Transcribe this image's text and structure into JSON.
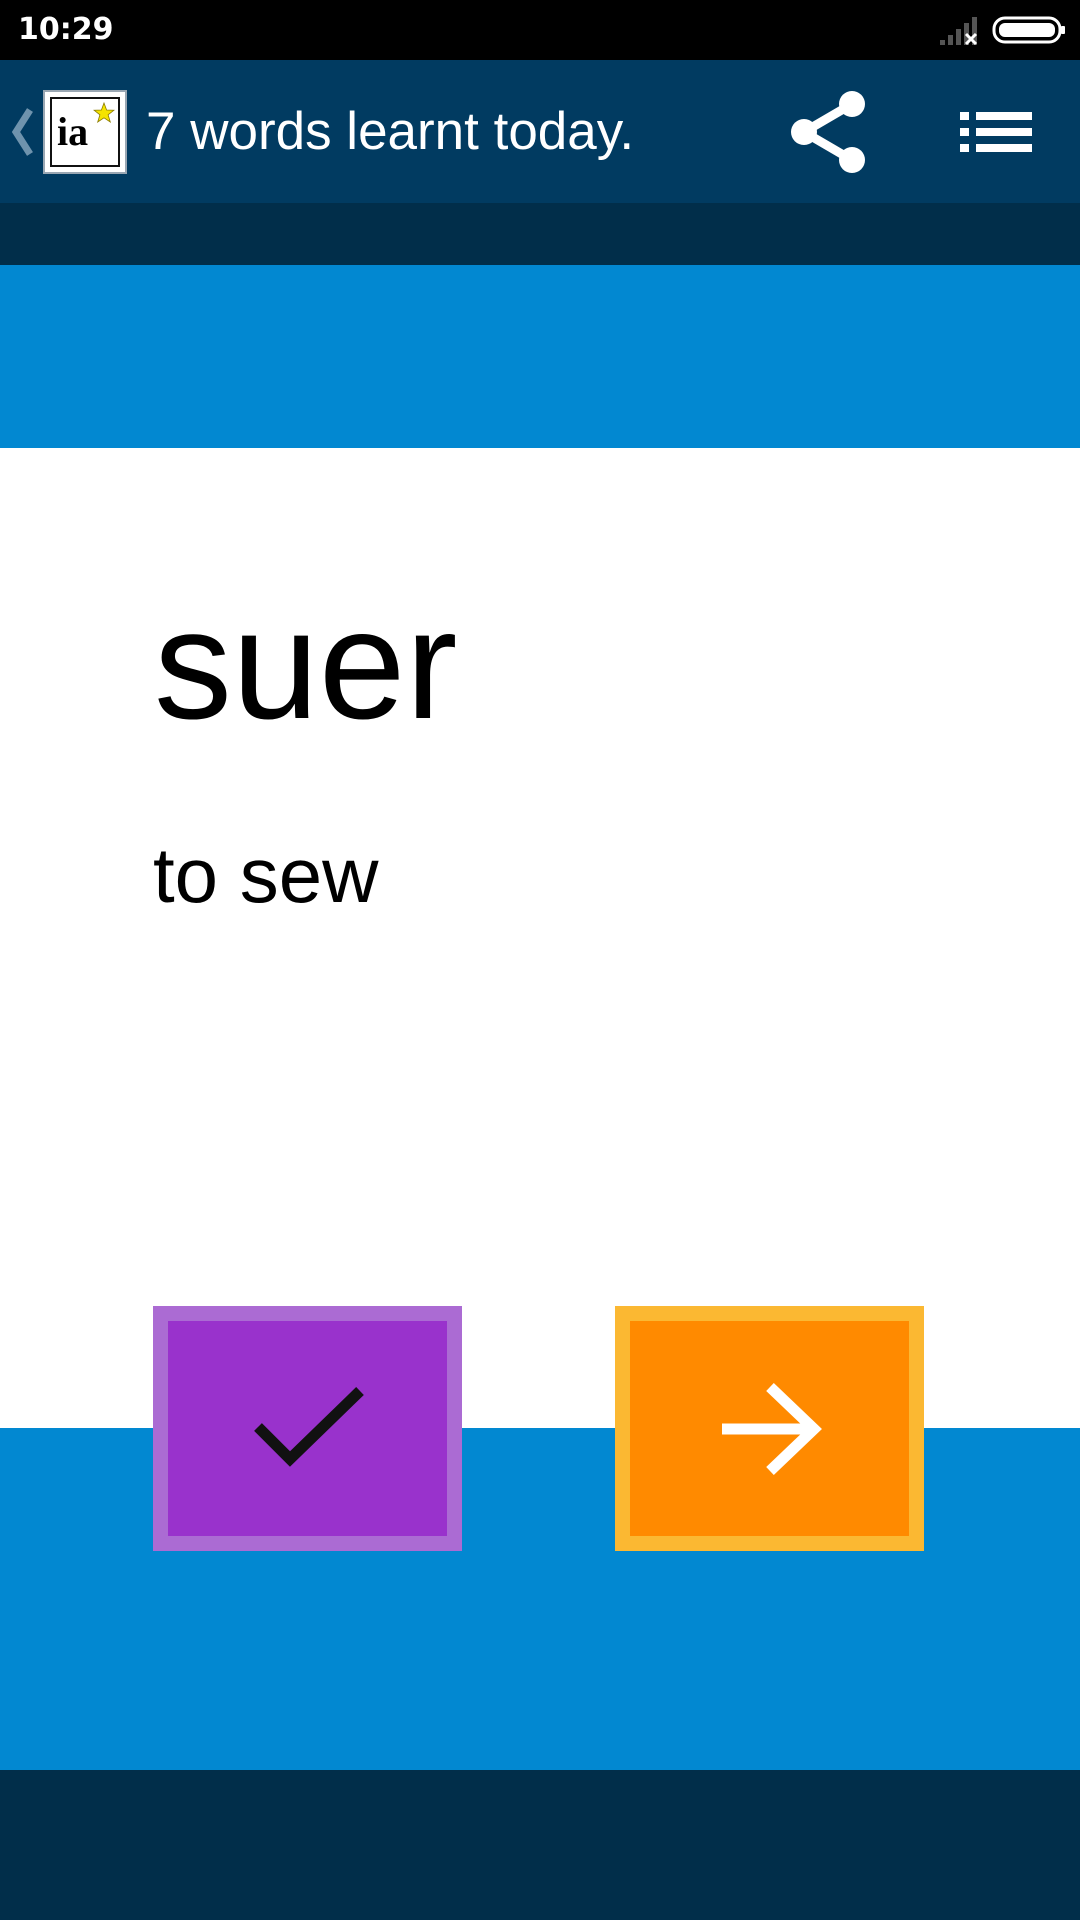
{
  "status_bar": {
    "time": "10:29",
    "signal_icon": "signal-no-service-icon",
    "battery_icon": "battery-full-icon"
  },
  "app_bar": {
    "back_icon": "chevron-left-icon",
    "logo_text": "ia",
    "logo_star_icon": "star-icon",
    "title": "7 words learnt today.",
    "share_icon": "share-icon",
    "menu_icon": "list-menu-icon"
  },
  "card": {
    "word": "suer",
    "translation": "to sew"
  },
  "actions": {
    "known_icon": "checkmark-icon",
    "next_icon": "arrow-right-icon"
  },
  "colors": {
    "app_bar": "#013b61",
    "dark_band": "#012e4a",
    "blue_band": "#0288d1",
    "known_fill": "#9932cc",
    "known_border": "#ab6bd3",
    "next_fill": "#ff8a00",
    "next_border": "#fbb832",
    "logo_star": "#f5e400"
  }
}
